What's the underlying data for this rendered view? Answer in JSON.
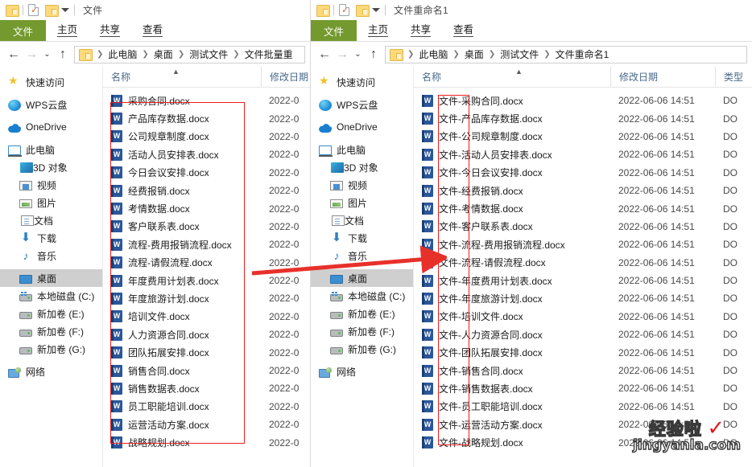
{
  "left_window": {
    "title": "文件",
    "quick_access": {
      "folder_icon": "folder-icon",
      "properties_icon": "properties-check-icon",
      "new_folder_icon": "folder-icon",
      "dropdown_icon": "chevron-down-icon"
    },
    "ribbon_tabs": [
      {
        "label": "文件",
        "active": true
      },
      {
        "label": "主页",
        "active": false
      },
      {
        "label": "共享",
        "active": false
      },
      {
        "label": "查看",
        "active": false
      }
    ],
    "nav": {
      "back_icon": "back-arrow-icon",
      "forward_icon": "forward-arrow-icon",
      "recent_icon": "chevron-down-icon",
      "up_icon": "up-arrow-icon"
    },
    "breadcrumb": [
      "此电脑",
      "桌面",
      "测试文件",
      "文件批量重"
    ],
    "sidebar": [
      {
        "label": "快速访问",
        "icon": "star-icon",
        "indent": false,
        "selected": false
      },
      {
        "label": "WPS云盘",
        "icon": "wps-cloud-icon",
        "indent": false,
        "selected": false
      },
      {
        "label": "OneDrive",
        "icon": "onedrive-icon",
        "indent": false,
        "selected": false
      },
      {
        "label": "此电脑",
        "icon": "this-pc-icon",
        "indent": false,
        "selected": false
      },
      {
        "label": "3D 对象",
        "icon": "3d-objects-icon",
        "indent": true,
        "selected": false
      },
      {
        "label": "视频",
        "icon": "videos-icon",
        "indent": true,
        "selected": false
      },
      {
        "label": "图片",
        "icon": "pictures-icon",
        "indent": true,
        "selected": false
      },
      {
        "label": "文档",
        "icon": "documents-icon",
        "indent": true,
        "selected": false
      },
      {
        "label": "下载",
        "icon": "downloads-icon",
        "indent": true,
        "selected": false
      },
      {
        "label": "音乐",
        "icon": "music-icon",
        "indent": true,
        "selected": false
      },
      {
        "label": "桌面",
        "icon": "desktop-icon",
        "indent": true,
        "selected": true
      },
      {
        "label": "本地磁盘 (C:)",
        "icon": "local-disk-icon",
        "indent": true,
        "selected": false
      },
      {
        "label": "新加卷 (E:)",
        "icon": "drive-icon",
        "indent": true,
        "selected": false
      },
      {
        "label": "新加卷 (F:)",
        "icon": "drive-icon",
        "indent": true,
        "selected": false
      },
      {
        "label": "新加卷 (G:)",
        "icon": "drive-icon",
        "indent": true,
        "selected": false
      },
      {
        "label": "网络",
        "icon": "network-icon",
        "indent": false,
        "selected": false
      }
    ],
    "columns": [
      {
        "label": "名称",
        "sorted": true
      },
      {
        "label": "修改日期",
        "sorted": false
      }
    ],
    "files": [
      {
        "name": "采购合同.docx",
        "date": "2022-0"
      },
      {
        "name": "产品库存数据.docx",
        "date": "2022-0"
      },
      {
        "name": "公司规章制度.docx",
        "date": "2022-0"
      },
      {
        "name": "活动人员安排表.docx",
        "date": "2022-0"
      },
      {
        "name": "今日会议安排.docx",
        "date": "2022-0"
      },
      {
        "name": "经费报销.docx",
        "date": "2022-0"
      },
      {
        "name": "考情数据.docx",
        "date": "2022-0"
      },
      {
        "name": "客户联系表.docx",
        "date": "2022-0"
      },
      {
        "name": "流程-费用报销流程.docx",
        "date": "2022-0"
      },
      {
        "name": "流程-请假流程.docx",
        "date": "2022-0"
      },
      {
        "name": "年度费用计划表.docx",
        "date": "2022-0"
      },
      {
        "name": "年度旅游计划.docx",
        "date": "2022-0"
      },
      {
        "name": "培训文件.docx",
        "date": "2022-0"
      },
      {
        "name": "人力资源合同.docx",
        "date": "2022-0"
      },
      {
        "name": "团队拓展安排.docx",
        "date": "2022-0"
      },
      {
        "name": "销售合同.docx",
        "date": "2022-0"
      },
      {
        "name": "销售数据表.docx",
        "date": "2022-0"
      },
      {
        "name": "员工职能培训.docx",
        "date": "2022-0"
      },
      {
        "name": "运营活动方案.docx",
        "date": "2022-0"
      },
      {
        "name": "战略规划.docx",
        "date": "2022-0"
      }
    ]
  },
  "right_window": {
    "title": "文件重命名1",
    "ribbon_tabs": [
      {
        "label": "文件",
        "active": true
      },
      {
        "label": "主页",
        "active": false
      },
      {
        "label": "共享",
        "active": false
      },
      {
        "label": "查看",
        "active": false
      }
    ],
    "breadcrumb": [
      "此电脑",
      "桌面",
      "测试文件",
      "文件重命名1"
    ],
    "sidebar": [
      {
        "label": "快速访问",
        "icon": "star-icon",
        "indent": false,
        "selected": false
      },
      {
        "label": "WPS云盘",
        "icon": "wps-cloud-icon",
        "indent": false,
        "selected": false
      },
      {
        "label": "OneDrive",
        "icon": "onedrive-icon",
        "indent": false,
        "selected": false
      },
      {
        "label": "此电脑",
        "icon": "this-pc-icon",
        "indent": false,
        "selected": false
      },
      {
        "label": "3D 对象",
        "icon": "3d-objects-icon",
        "indent": true,
        "selected": false
      },
      {
        "label": "视频",
        "icon": "videos-icon",
        "indent": true,
        "selected": false
      },
      {
        "label": "图片",
        "icon": "pictures-icon",
        "indent": true,
        "selected": false
      },
      {
        "label": "文档",
        "icon": "documents-icon",
        "indent": true,
        "selected": false
      },
      {
        "label": "下载",
        "icon": "downloads-icon",
        "indent": true,
        "selected": false
      },
      {
        "label": "音乐",
        "icon": "music-icon",
        "indent": true,
        "selected": false
      },
      {
        "label": "桌面",
        "icon": "desktop-icon",
        "indent": true,
        "selected": true
      },
      {
        "label": "本地磁盘 (C:)",
        "icon": "local-disk-icon",
        "indent": true,
        "selected": false
      },
      {
        "label": "新加卷 (E:)",
        "icon": "drive-icon",
        "indent": true,
        "selected": false
      },
      {
        "label": "新加卷 (F:)",
        "icon": "drive-icon",
        "indent": true,
        "selected": false
      },
      {
        "label": "新加卷 (G:)",
        "icon": "drive-icon",
        "indent": true,
        "selected": false
      },
      {
        "label": "网络",
        "icon": "network-icon",
        "indent": false,
        "selected": false
      }
    ],
    "columns": [
      {
        "label": "名称",
        "sorted": true
      },
      {
        "label": "修改日期",
        "sorted": false
      },
      {
        "label": "类型",
        "sorted": false
      }
    ],
    "files": [
      {
        "name": "文件-采购合同.docx",
        "date": "2022-06-06 14:51",
        "type": "DO"
      },
      {
        "name": "文件-产品库存数据.docx",
        "date": "2022-06-06 14:51",
        "type": "DO"
      },
      {
        "name": "文件-公司规章制度.docx",
        "date": "2022-06-06 14:51",
        "type": "DO"
      },
      {
        "name": "文件-活动人员安排表.docx",
        "date": "2022-06-06 14:51",
        "type": "DO"
      },
      {
        "name": "文件-今日会议安排.docx",
        "date": "2022-06-06 14:51",
        "type": "DO"
      },
      {
        "name": "文件-经费报销.docx",
        "date": "2022-06-06 14:51",
        "type": "DO"
      },
      {
        "name": "文件-考情数据.docx",
        "date": "2022-06-06 14:51",
        "type": "DO"
      },
      {
        "name": "文件-客户联系表.docx",
        "date": "2022-06-06 14:51",
        "type": "DO"
      },
      {
        "name": "文件-流程-费用报销流程.docx",
        "date": "2022-06-06 14:51",
        "type": "DO"
      },
      {
        "name": "文件-流程-请假流程.docx",
        "date": "2022-06-06 14:51",
        "type": "DO"
      },
      {
        "name": "文件-年度费用计划表.docx",
        "date": "2022-06-06 14:51",
        "type": "DO"
      },
      {
        "name": "文件-年度旅游计划.docx",
        "date": "2022-06-06 14:51",
        "type": "DO"
      },
      {
        "name": "文件-培训文件.docx",
        "date": "2022-06-06 14:51",
        "type": "DO"
      },
      {
        "name": "文件-人力资源合同.docx",
        "date": "2022-06-06 14:51",
        "type": "DO"
      },
      {
        "name": "文件-团队拓展安排.docx",
        "date": "2022-06-06 14:51",
        "type": "DO"
      },
      {
        "name": "文件-销售合同.docx",
        "date": "2022-06-06 14:51",
        "type": "DO"
      },
      {
        "name": "文件-销售数据表.docx",
        "date": "2022-06-06 14:51",
        "type": "DO"
      },
      {
        "name": "文件-员工职能培训.docx",
        "date": "2022-06-06 14:51",
        "type": "DO"
      },
      {
        "name": "文件-运营活动方案.docx",
        "date": "2022-06-06 14:51",
        "type": "DO"
      },
      {
        "name": "文件-战略规划.docx",
        "date": "2022-06-06 14:51",
        "type": "DO"
      }
    ]
  },
  "annotations": {
    "highlight_color": "#ee1c1c",
    "arrow_color": "#e8302a",
    "left_box_label": "original-filenames-highlight",
    "right_box_label": "prefix-highlight",
    "arrow_label": "rename-direction-arrow"
  },
  "watermark": {
    "top_text": "经验啦",
    "check": "✓",
    "bottom_text": "jingyanla.com"
  }
}
